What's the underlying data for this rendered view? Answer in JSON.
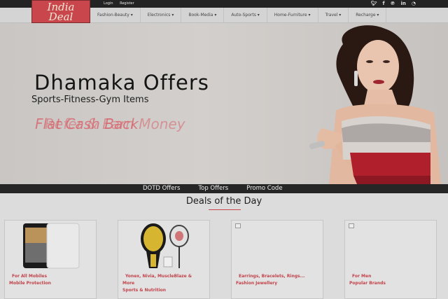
{
  "logo": {
    "line1": "India",
    "line2": "Deal"
  },
  "auth": {
    "login": "Login",
    "register": "Register"
  },
  "social": [
    "twitter-icon",
    "facebook-icon",
    "pinterest-icon",
    "linkedin-icon",
    "rss-icon"
  ],
  "nav": {
    "items": [
      "Fashion-Beauty",
      "Electronics",
      "Book-Media",
      "Auto-Sports",
      "Home-Furniture",
      "Travel",
      "Recharge"
    ]
  },
  "hero": {
    "title": "Dhamaka Offers",
    "subtitle": "Sports-Fitness-Gym Items",
    "ghost_a": "Flat Cash Back",
    "ghost_b": "Refer & Earn Money"
  },
  "tabs": [
    "DOTD Offers",
    "Top Offers",
    "Promo Code"
  ],
  "deals": {
    "title": "Deals of the Day",
    "cards": [
      {
        "l1": "For All Mobiles",
        "l2": "Mobile Protection",
        "l3": ""
      },
      {
        "l1": "Yonex, Nivia, MuscleBlaze &",
        "l2": "More",
        "l3": "Sports & Nutrition"
      },
      {
        "l1": "Earrings, Bracelets, Rings...",
        "l2": "Fashion Jewellery",
        "l3": ""
      },
      {
        "l1": "For Men",
        "l2": "Popular Brands",
        "l3": ""
      }
    ]
  },
  "colors": {
    "brand": "#c9474c",
    "topbar": "#232323",
    "link_red": "#c2434a"
  }
}
